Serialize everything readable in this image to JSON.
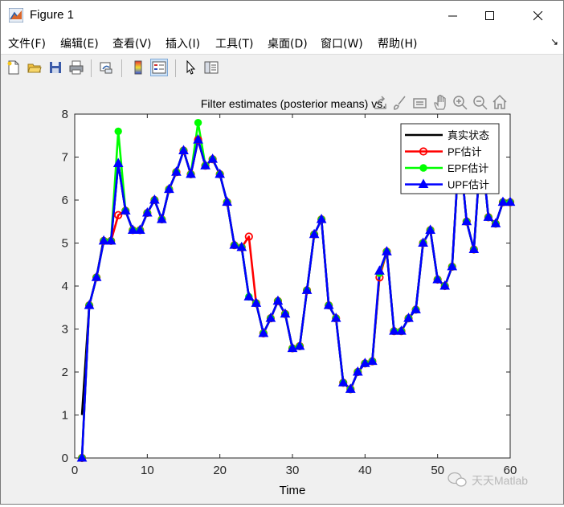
{
  "window": {
    "title": "Figure 1"
  },
  "menu": [
    {
      "label": "文件(F)"
    },
    {
      "label": "编辑(E)"
    },
    {
      "label": "查看(V)"
    },
    {
      "label": "插入(I)"
    },
    {
      "label": "工具(T)"
    },
    {
      "label": "桌面(D)"
    },
    {
      "label": "窗口(W)"
    },
    {
      "label": "帮助(H)"
    }
  ],
  "toolbar_icons": [
    "new-file-icon",
    "open-folder-icon",
    "save-icon",
    "print-icon",
    "link-plot-icon",
    "colorbar-icon",
    "legend-icon",
    "pointer-icon",
    "property-inspector-icon"
  ],
  "axes_toolbar_icons": [
    "export-icon",
    "brush-icon",
    "data-tips-icon",
    "pan-icon",
    "zoom-in-icon",
    "zoom-out-icon",
    "home-icon"
  ],
  "watermark": "天天Matlab",
  "chart_data": {
    "type": "line",
    "title": "Filter estimates (posterior means) vs.",
    "xlabel": "Time",
    "ylabel": "",
    "xlim": [
      0,
      60
    ],
    "ylim": [
      0,
      8
    ],
    "xticks": [
      0,
      10,
      20,
      30,
      40,
      50,
      60
    ],
    "yticks": [
      0,
      1,
      2,
      3,
      4,
      5,
      6,
      7,
      8
    ],
    "grid": false,
    "legend_position": "top-right",
    "x": [
      1,
      2,
      3,
      4,
      5,
      6,
      7,
      8,
      9,
      10,
      11,
      12,
      13,
      14,
      15,
      16,
      17,
      18,
      19,
      20,
      21,
      22,
      23,
      24,
      25,
      26,
      27,
      28,
      29,
      30,
      31,
      32,
      33,
      34,
      35,
      36,
      37,
      38,
      39,
      40,
      41,
      42,
      43,
      44,
      45,
      46,
      47,
      48,
      49,
      50,
      51,
      52,
      53,
      54,
      55,
      56,
      57,
      58,
      59,
      60
    ],
    "series": [
      {
        "name": "真实状态",
        "color": "#000000",
        "marker": "none",
        "values": [
          1.0,
          3.55,
          4.2,
          5.1,
          5.05,
          6.85,
          5.75,
          5.3,
          5.3,
          5.7,
          6.0,
          5.55,
          6.25,
          6.65,
          7.15,
          6.6,
          7.4,
          6.8,
          6.95,
          6.6,
          5.95,
          4.95,
          4.9,
          3.75,
          3.6,
          2.9,
          3.25,
          3.65,
          3.35,
          2.55,
          2.6,
          3.9,
          5.2,
          5.55,
          3.55,
          3.25,
          1.75,
          1.6,
          2.0,
          2.2,
          2.25,
          4.25,
          4.8,
          2.95,
          2.95,
          3.25,
          3.45,
          5.0,
          5.3,
          4.15,
          4.0,
          4.45,
          7.25,
          5.5,
          4.85,
          7.3,
          5.6,
          5.45,
          5.95,
          5.95
        ]
      },
      {
        "name": "PF估计",
        "color": "#ff0000",
        "marker": "circle",
        "values": [
          0.0,
          3.55,
          4.2,
          5.05,
          5.05,
          5.65,
          5.75,
          5.3,
          5.3,
          5.7,
          6.0,
          5.55,
          6.25,
          6.65,
          7.15,
          6.6,
          7.4,
          6.8,
          6.95,
          6.6,
          5.95,
          4.95,
          4.9,
          5.15,
          3.6,
          2.9,
          3.25,
          3.65,
          3.35,
          2.55,
          2.6,
          3.9,
          5.2,
          5.55,
          3.55,
          3.25,
          1.75,
          1.6,
          2.0,
          2.2,
          2.25,
          4.2,
          4.8,
          2.95,
          2.95,
          3.25,
          3.45,
          5.0,
          5.3,
          4.15,
          4.0,
          4.45,
          7.25,
          5.5,
          4.85,
          7.3,
          5.6,
          5.45,
          5.95,
          5.95
        ]
      },
      {
        "name": "EPF估计",
        "color": "#00ff00",
        "marker": "dot",
        "values": [
          0.0,
          3.55,
          4.2,
          5.05,
          5.05,
          7.6,
          5.75,
          5.3,
          5.3,
          5.7,
          6.0,
          5.55,
          6.25,
          6.65,
          7.15,
          6.6,
          7.8,
          6.8,
          6.95,
          6.6,
          5.95,
          4.95,
          4.9,
          3.75,
          3.6,
          2.9,
          3.25,
          3.65,
          3.35,
          2.55,
          2.6,
          3.9,
          5.2,
          5.55,
          3.55,
          3.25,
          1.75,
          1.6,
          2.0,
          2.2,
          2.25,
          4.3,
          4.8,
          2.95,
          2.95,
          3.25,
          3.45,
          5.0,
          5.3,
          4.15,
          4.0,
          4.45,
          7.25,
          5.5,
          4.85,
          7.3,
          5.6,
          5.45,
          5.95,
          5.95
        ]
      },
      {
        "name": "UPF估计",
        "color": "#0000ff",
        "marker": "triangle",
        "values": [
          0.0,
          3.55,
          4.2,
          5.05,
          5.05,
          6.85,
          5.75,
          5.3,
          5.3,
          5.7,
          6.0,
          5.55,
          6.25,
          6.65,
          7.15,
          6.6,
          7.4,
          6.8,
          6.95,
          6.6,
          5.95,
          4.95,
          4.9,
          3.75,
          3.6,
          2.9,
          3.25,
          3.65,
          3.35,
          2.55,
          2.6,
          3.9,
          5.2,
          5.55,
          3.55,
          3.25,
          1.75,
          1.6,
          2.0,
          2.2,
          2.25,
          4.35,
          4.8,
          2.95,
          2.95,
          3.25,
          3.45,
          5.0,
          5.3,
          4.15,
          4.0,
          4.45,
          7.25,
          5.5,
          4.85,
          7.3,
          5.6,
          5.45,
          5.95,
          5.95
        ]
      }
    ]
  }
}
